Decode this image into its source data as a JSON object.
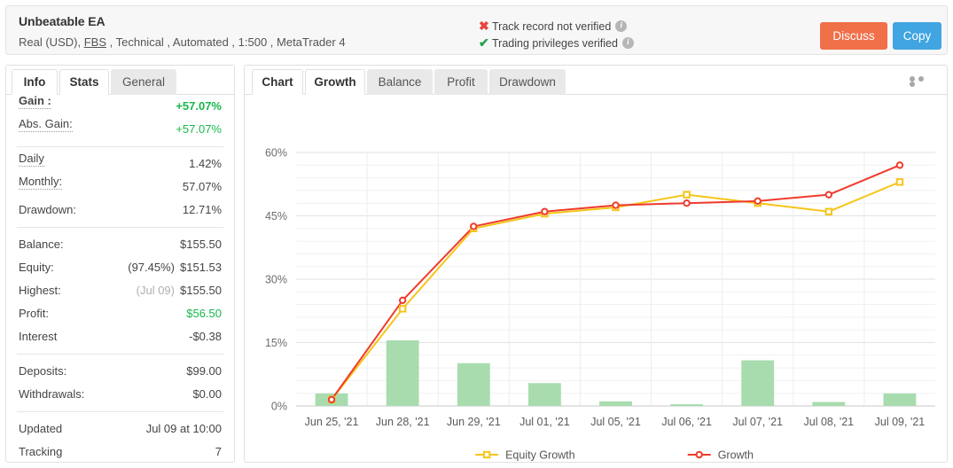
{
  "header": {
    "title": "Unbeatable EA",
    "subtitle_parts": [
      "Real (USD),",
      "FBS",
      ", Technical , Automated , 1:500 , MetaTrader 4"
    ],
    "verification": [
      {
        "icon": "x-mark-icon",
        "mark": "✖",
        "text": "Track record not verified",
        "info": "i",
        "status_color": "#e8453c"
      },
      {
        "icon": "check-mark-icon",
        "mark": "✔",
        "text": "Trading privileges verified",
        "info": "i",
        "status_color": "#22a34a"
      }
    ],
    "discuss_label": "Discuss",
    "copy_label": "Copy",
    "discuss_color": "#f0704a",
    "copy_color": "#40a5e0"
  },
  "sidebar": {
    "tabs": [
      {
        "label": "Info",
        "active": false
      },
      {
        "label": "Stats",
        "active": true
      },
      {
        "label": "General",
        "active": false
      }
    ],
    "stats": [
      {
        "label": "Gain :",
        "value": "+57.07%",
        "bold": true,
        "green": true,
        "underline": "dotted"
      },
      {
        "label": "Abs. Gain:",
        "value": "+57.07%",
        "bold": false,
        "green": true,
        "underline": "dotted"
      },
      {
        "label": "Daily",
        "value": "1.42%",
        "bold": false,
        "green": false,
        "underline": "dotted"
      },
      {
        "label": "Monthly:",
        "value": "57.07%",
        "bold": false,
        "green": false,
        "underline": "dotted"
      },
      {
        "label": "Drawdown:",
        "value": "12.71%",
        "bold": false,
        "green": false,
        "underline": "none"
      },
      {
        "label": "Balance:",
        "value": "$155.50",
        "bold": false,
        "green": false,
        "underline": "none"
      },
      {
        "label": "Equity:",
        "value": "$151.53",
        "prefix": "(97.45%)",
        "bold": false,
        "green": false,
        "underline": "none"
      },
      {
        "label": "Highest:",
        "value": "$155.50",
        "prefix": "(Jul 09)",
        "bold": false,
        "green": false,
        "underline": "none"
      },
      {
        "label": "Profit:",
        "value": "$56.50",
        "bold": false,
        "green": true,
        "underline": "none"
      },
      {
        "label": "Interest",
        "value": "-$0.38",
        "bold": false,
        "green": false,
        "underline": "none"
      },
      {
        "label": "Deposits:",
        "value": "$99.00",
        "bold": false,
        "green": false,
        "underline": "none"
      },
      {
        "label": "Withdrawals:",
        "value": "$0.00",
        "bold": false,
        "green": false,
        "underline": "none"
      },
      {
        "label": "Updated",
        "value": "Jul 09 at 10:00",
        "bold": false,
        "green": false,
        "underline": "none"
      },
      {
        "label": "Tracking",
        "value": "7",
        "bold": false,
        "green": false,
        "underline": "none"
      }
    ]
  },
  "chart_panel": {
    "tabs": [
      {
        "label": "Chart",
        "active": false,
        "plain": true
      },
      {
        "label": "Growth",
        "active": true,
        "plain": false
      },
      {
        "label": "Balance",
        "active": false,
        "plain": false
      },
      {
        "label": "Profit",
        "active": false,
        "plain": false
      },
      {
        "label": "Drawdown",
        "active": false,
        "plain": false
      }
    ],
    "menu_icon": "more-options-icon"
  },
  "chart_data": {
    "type": "line",
    "title": "",
    "xlabel": "",
    "ylabel": "",
    "ylim": [
      0,
      60
    ],
    "yticks": [
      0,
      15,
      30,
      45,
      60
    ],
    "ytick_labels": [
      "0%",
      "15%",
      "30%",
      "45%",
      "60%"
    ],
    "grid": true,
    "legend_position": "bottom",
    "categories": [
      "Jun 25, '21",
      "Jun 28, '21",
      "Jun 29, '21",
      "Jul 01, '21",
      "Jul 05, '21",
      "Jul 06, '21",
      "Jul 07, '21",
      "Jul 08, '21",
      "Jul 09, '21"
    ],
    "series": [
      {
        "name": "Equity Growth",
        "color": "#f5c518",
        "marker": "square-open",
        "values": [
          1.5,
          23.0,
          42.0,
          45.5,
          47.0,
          50.0,
          48.0,
          46.0,
          53.0
        ]
      },
      {
        "name": "Growth",
        "color": "#ef3b2c",
        "marker": "circle-open",
        "values": [
          1.5,
          25.0,
          42.5,
          46.0,
          47.5,
          48.0,
          48.5,
          50.0,
          57.0
        ]
      },
      {
        "name": "Volume bars",
        "type": "bar",
        "color": "#a8dcae",
        "values": [
          2.2,
          11.5,
          7.5,
          4.0,
          0.8,
          0.3,
          8.0,
          0.7,
          2.2
        ]
      }
    ]
  }
}
